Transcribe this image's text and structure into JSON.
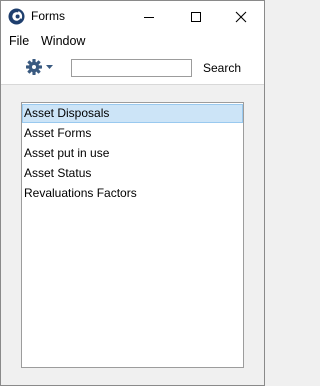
{
  "window": {
    "title": "Forms",
    "controls": {
      "minimize_icon": "minimize-icon",
      "maximize_icon": "maximize-icon",
      "close_icon": "close-icon"
    }
  },
  "menu": {
    "items": [
      {
        "label": "File"
      },
      {
        "label": "Window"
      }
    ]
  },
  "toolbar": {
    "gear_icon": "gear-icon",
    "search_value": "",
    "search_label": "Search"
  },
  "list": {
    "items": [
      {
        "label": "Asset Disposals",
        "selected": true
      },
      {
        "label": "Asset Forms",
        "selected": false
      },
      {
        "label": "Asset put in use",
        "selected": false
      },
      {
        "label": "Asset Status",
        "selected": false
      },
      {
        "label": "Revaluations Factors",
        "selected": false
      }
    ]
  },
  "colors": {
    "selection_bg": "#cce4f7",
    "selection_border": "#99c9ef",
    "window_bg": "#f0f0f0"
  }
}
